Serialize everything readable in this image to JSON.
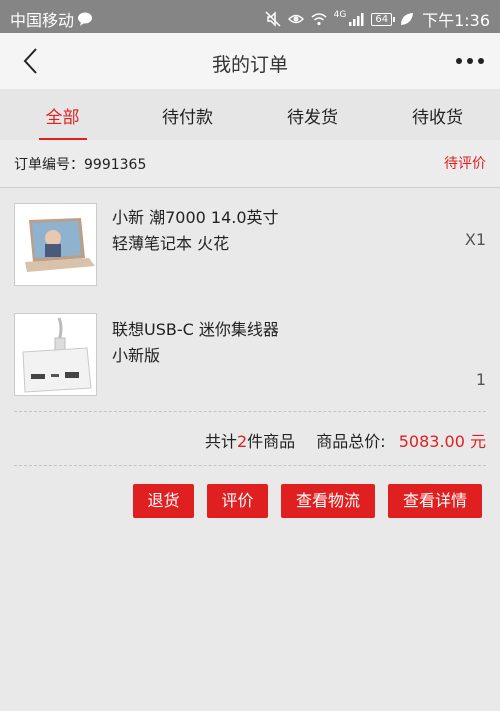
{
  "status_bar": {
    "carrier": "中国移动",
    "network": "4G",
    "battery": "64",
    "time": "下午1:36"
  },
  "nav": {
    "title": "我的订单"
  },
  "tabs": [
    {
      "label": "全部",
      "active": true
    },
    {
      "label": "待付款",
      "active": false
    },
    {
      "label": "待发货",
      "active": false
    },
    {
      "label": "待收货",
      "active": false
    }
  ],
  "order": {
    "number_text": "订单编号：9991365",
    "status": "待评价",
    "items": [
      {
        "name": "小新 潮7000 14.0英寸轻薄笔记本 火花",
        "qty": "X1",
        "icon": "laptop-image"
      },
      {
        "name": "联想USB-C 迷你集线器 小新版",
        "qty": "1",
        "icon": "usb-hub-image"
      }
    ],
    "summary": {
      "count_prefix": "共计",
      "count": "2",
      "count_suffix": "件商品",
      "total_label": "商品总价:",
      "total_value": "5083.00 元"
    },
    "actions": [
      {
        "label": "退货"
      },
      {
        "label": "评价"
      },
      {
        "label": "查看物流"
      },
      {
        "label": "查看详情"
      }
    ]
  },
  "colors": {
    "accent": "#e02020",
    "status_bar": "#858585",
    "background": "#e9e9e9"
  }
}
